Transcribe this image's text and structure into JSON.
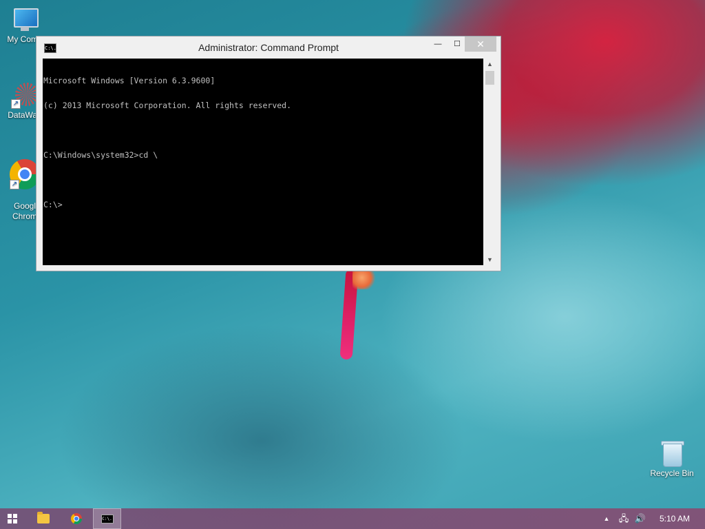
{
  "desktop": {
    "icons": [
      {
        "label": "My Comp"
      },
      {
        "label": "DataWag"
      },
      {
        "label": "Googl\nChrom"
      },
      {
        "label": "Recycle Bin"
      }
    ]
  },
  "window": {
    "title": "Administrator: Command Prompt",
    "close_glyph": "✕",
    "minimize_glyph": "—",
    "maximize_glyph": "☐",
    "console_lines": [
      "Microsoft Windows [Version 6.3.9600]",
      "(c) 2013 Microsoft Corporation. All rights reserved.",
      "",
      "C:\\Windows\\system32>cd \\",
      "",
      "C:\\>"
    ]
  },
  "taskbar": {
    "clock": "5:10 AM",
    "cmd_icon_text": "C:\\."
  }
}
